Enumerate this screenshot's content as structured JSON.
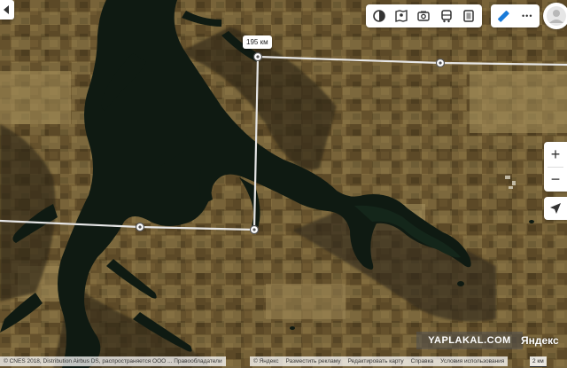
{
  "ruler": {
    "distance_label": "195 км"
  },
  "toolbar": {
    "buttons": [
      {
        "name": "layers",
        "icon": "layers-icon"
      },
      {
        "name": "panorama",
        "icon": "panorama-icon"
      },
      {
        "name": "photos",
        "icon": "camera-icon"
      },
      {
        "name": "transit",
        "icon": "bus-icon"
      },
      {
        "name": "traffic",
        "icon": "traffic-icon"
      }
    ],
    "extra": [
      {
        "name": "ruler",
        "icon": "ruler-icon"
      },
      {
        "name": "more",
        "icon": "more-icon",
        "label": "•••"
      }
    ]
  },
  "zoom": {
    "in_label": "+",
    "out_label": "−"
  },
  "watermark": {
    "text": "YAPLAKAL.COM"
  },
  "brand": {
    "text": "Яндекс"
  },
  "copyright": {
    "text": "© CNES 2018, Distribution Airbus DS, распространяется ООО ...  Правообладатели"
  },
  "footer": {
    "links": [
      "© Яндекс",
      "Разместить рекламу",
      "Редактировать карту",
      "Справка",
      "Условия использования"
    ]
  },
  "scale": {
    "label": "2 км"
  },
  "colors": {
    "water": "#0f1a12",
    "land_dark": "#4a3d22",
    "land_light": "#9a8452",
    "ruler_line": "#e8e8e8",
    "accent_blue": "#1a7bd9"
  }
}
